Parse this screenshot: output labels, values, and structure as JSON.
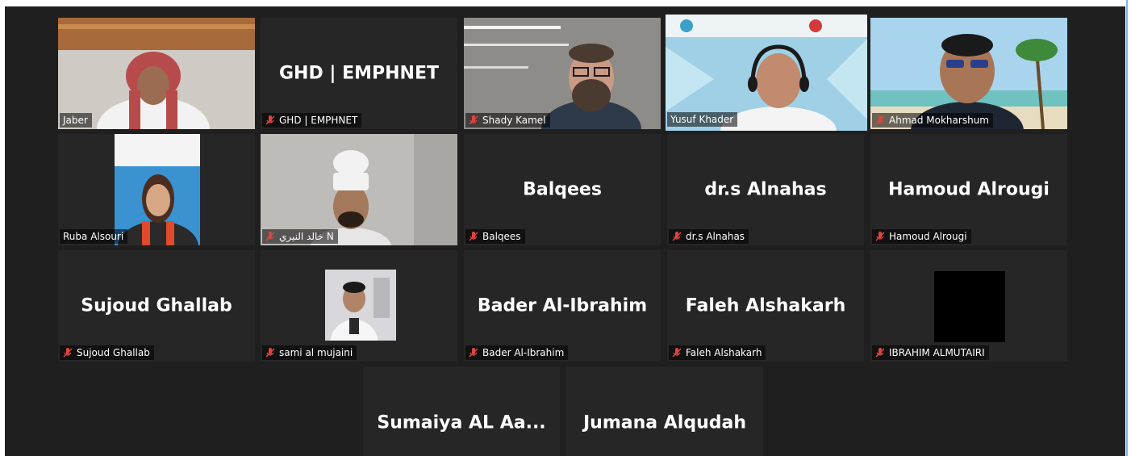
{
  "meeting": {
    "participants": [
      {
        "name": "Jaber",
        "muted": false,
        "has_video": true
      },
      {
        "name": "GHD | EMPHNET",
        "muted": true,
        "has_video": false
      },
      {
        "name": "Shady Kamel",
        "muted": true,
        "has_video": true
      },
      {
        "name": "Yusuf Khader",
        "muted": false,
        "has_video": true,
        "active_speaker": true
      },
      {
        "name": "Ahmad Mokharshum",
        "muted": true,
        "has_video": true
      },
      {
        "name": "Ruba Alsouri",
        "muted": false,
        "has_video": true
      },
      {
        "name": "خالد النيري N",
        "muted": true,
        "has_video": true
      },
      {
        "name": "Balqees",
        "muted": true,
        "has_video": false
      },
      {
        "name": "dr.s Alnahas",
        "muted": true,
        "has_video": false
      },
      {
        "name": "Hamoud Alrougi",
        "muted": true,
        "has_video": false
      },
      {
        "name": "Sujoud Ghallab",
        "muted": true,
        "has_video": false
      },
      {
        "name": "sami al mujaini",
        "muted": true,
        "has_video": false,
        "profile_photo": true
      },
      {
        "name": "Bader Al-Ibrahim",
        "muted": true,
        "has_video": false
      },
      {
        "name": "Faleh Alshakarh",
        "muted": true,
        "has_video": false
      },
      {
        "name": "IBRAHIM ALMUTAIRI",
        "muted": true,
        "has_video": false,
        "profile_photo": true
      },
      {
        "name": "Sumaiya  AL  Aa...",
        "has_video": false
      },
      {
        "name": "Jumana Alqudah",
        "has_video": false
      }
    ]
  },
  "icons": {
    "muted": "muted-mic-icon"
  },
  "colors": {
    "grid_background": "#1f1f1f",
    "tile_background": "#262626",
    "active_speaker_border": "#9fd04a",
    "muted_icon": "#e0443e"
  }
}
